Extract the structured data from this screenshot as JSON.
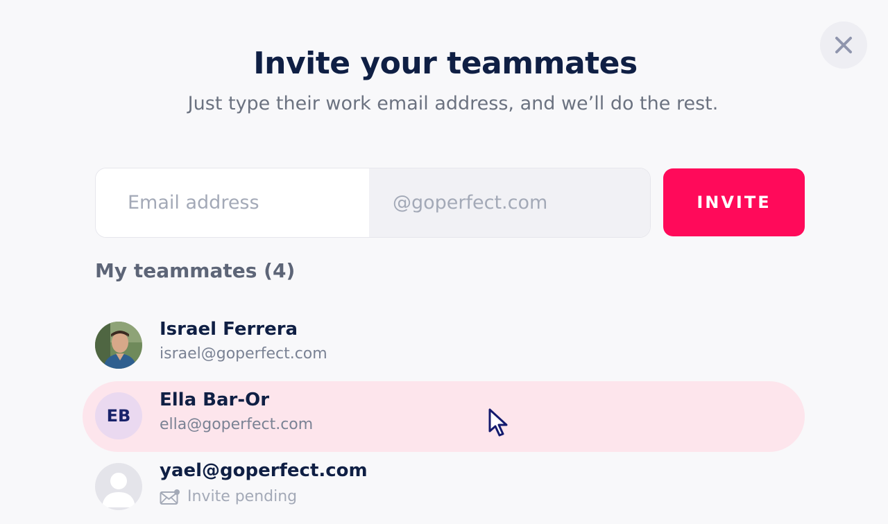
{
  "modal": {
    "title": "Invite your teammates",
    "subtitle": "Just type their work email address, and we’ll do the rest."
  },
  "form": {
    "email_placeholder": "Email address",
    "email_value": "",
    "domain_suffix": "@goperfect.com",
    "invite_label": "INVITE"
  },
  "teammates": {
    "heading": "My teammates (4)",
    "members": [
      {
        "name": "Israel Ferrera",
        "email": "israel@goperfect.com",
        "avatar": "photo"
      },
      {
        "name": "Ella Bar-Or",
        "email": "ella@goperfect.com",
        "initials": "EB"
      },
      {
        "name": "yael@goperfect.com",
        "status": "Invite pending",
        "avatar": "placeholder-user-icon"
      }
    ]
  },
  "colors": {
    "accent": "#ff0a5a",
    "title": "#0f1f44",
    "highlight_row": "#fde5ec",
    "initials_avatar_bg": "#ead9f0"
  },
  "icons": [
    "close-icon",
    "envelope-icon",
    "user-placeholder-icon",
    "mouse-cursor-icon"
  ]
}
